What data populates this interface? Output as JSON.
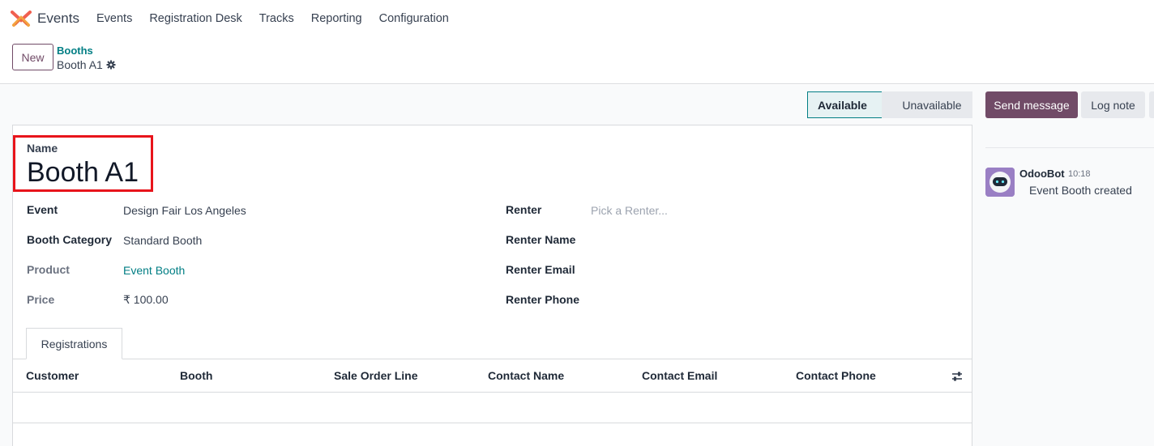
{
  "navbar": {
    "app_name": "Events",
    "menu": [
      "Events",
      "Registration Desk",
      "Tracks",
      "Reporting",
      "Configuration"
    ]
  },
  "control_panel": {
    "new_label": "New",
    "breadcrumb_parent": "Booths",
    "breadcrumb_current": "Booth A1"
  },
  "statusbar": {
    "states": [
      "Available",
      "Unavailable"
    ],
    "active": "Available"
  },
  "chatter": {
    "send_label": "Send message",
    "log_label": "Log note",
    "messages": [
      {
        "author": "OdooBot",
        "time": "10:18",
        "body": "Event Booth created"
      }
    ]
  },
  "form": {
    "name_label": "Name",
    "name_value": "Booth A1",
    "left_fields": [
      {
        "label": "Event",
        "value": "Design Fair Los Angeles"
      },
      {
        "label": "Booth Category",
        "value": "Standard Booth"
      },
      {
        "label": "Product",
        "value": "Event Booth"
      },
      {
        "label": "Price",
        "value": "₹ 100.00"
      }
    ],
    "right_fields": [
      {
        "label": "Renter",
        "placeholder": "Pick a Renter..."
      },
      {
        "label": "Renter Name",
        "value": ""
      },
      {
        "label": "Renter Email",
        "value": ""
      },
      {
        "label": "Renter Phone",
        "value": ""
      }
    ]
  },
  "tabs": [
    "Registrations"
  ],
  "table": {
    "columns": [
      "Customer",
      "Booth",
      "Sale Order Line",
      "Contact Name",
      "Contact Email",
      "Contact Phone"
    ]
  },
  "colors": {
    "brand_purple": "#714b67",
    "link_teal": "#017e84",
    "highlight_red": "#e8141b"
  }
}
